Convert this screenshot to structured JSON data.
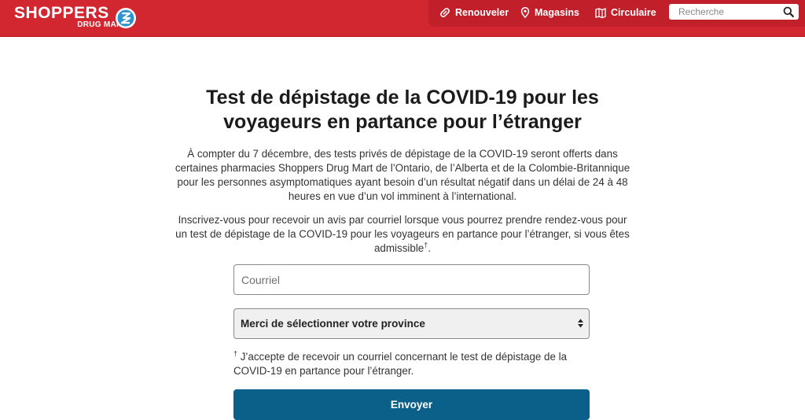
{
  "header": {
    "logo": {
      "line1": "SHOPPERS",
      "line2": "DRUG MART"
    },
    "nav": [
      {
        "label": "Renouveler",
        "icon": "pill-icon"
      },
      {
        "label": "Magasins",
        "icon": "location-pin-icon"
      },
      {
        "label": "Circulaire",
        "icon": "flyer-map-icon"
      }
    ],
    "search": {
      "placeholder": "Recherche",
      "icon": "search-icon"
    },
    "brand_color": "#d22630"
  },
  "main": {
    "title": "Test de dépistage de la COVID-19 pour les voyageurs en partance pour l’étranger",
    "paragraph1": "À compter du 7 décembre, des tests privés de dépistage de la COVID-19 seront offerts dans certaines pharmacies Shoppers Drug Mart de l’Ontario, de l’Alberta et de la Colombie-Britannique pour les personnes asymptomatiques ayant besoin d’un résultat négatif dans un délai de 24 à 48 heures en vue d’un vol imminent à l’international.",
    "paragraph2": "Inscrivez-vous pour recevoir un avis par courriel lorsque vous pourrez prendre rendez-vous pour un test de dépistage de la COVID-19 pour les voyageurs en partance pour l’étranger, si vous êtes admissible",
    "paragraph2_mark": "†",
    "paragraph2_end": ".",
    "form": {
      "email_placeholder": "Courriel",
      "email_value": "",
      "province_selected": "Merci de sélectionner votre province",
      "consent_mark": "†",
      "consent_text": " J’accepte de recevoir un courriel concernant le test de dépistage de la COVID-19 en partance pour l’étranger.",
      "submit_label": "Envoyer",
      "button_color": "#0b6089"
    }
  }
}
